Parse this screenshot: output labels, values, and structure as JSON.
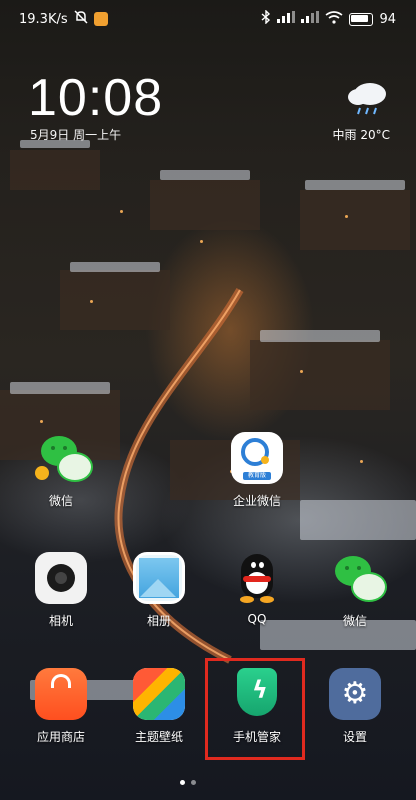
{
  "status_bar": {
    "speed": "19.3K/s",
    "battery": "94"
  },
  "clock": {
    "time": "10:08",
    "date": "5月9日 周一上午"
  },
  "weather": {
    "text": "中雨 20°C"
  },
  "apps": {
    "wechat1": "微信",
    "wework": "企业微信",
    "wework_badge": "教育版",
    "camera": "相机",
    "gallery": "相册",
    "qq": "QQ",
    "wechat2": "微信",
    "store": "应用商店",
    "themes": "主题壁纸",
    "security": "手机管家",
    "settings": "设置"
  },
  "colors": {
    "highlight": "#e02a1f",
    "wechat_green": "#2fc043"
  }
}
